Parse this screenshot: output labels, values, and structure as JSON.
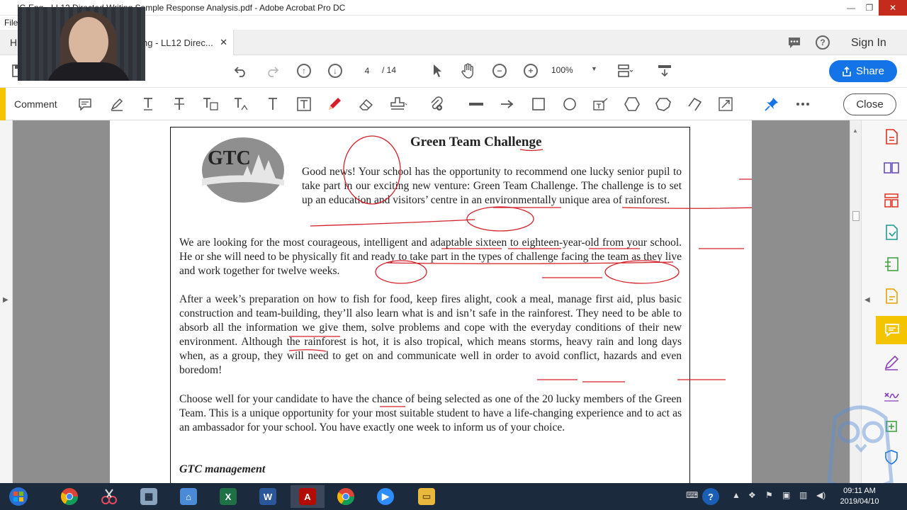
{
  "window": {
    "title": "IG Eng - LL12 Directed Writing Sample Response Analysis.pdf - Adobe Acrobat Pro DC",
    "minimize": "—",
    "maximize": "❐",
    "close": "✕"
  },
  "menu": {
    "file": "File"
  },
  "tabs": {
    "home": "H",
    "document": "ng - LL12 Direc...",
    "close": "✕",
    "sign_in": "Sign In"
  },
  "toolbar": {
    "page_current": "4",
    "page_total": "/ 14",
    "zoom": "100%",
    "share_label": "Share"
  },
  "comment_bar": {
    "label": "Comment",
    "close_label": "Close"
  },
  "document": {
    "title": "Green Team Challenge",
    "logo_text": "GTC",
    "paragraph1": "Good news! Your school has the opportunity to recommend one lucky senior pupil to take part in our exciting new venture: Green Team Challenge. The challenge is to set up an education and visitors’ centre in an environmentally unique area of rainforest.",
    "paragraph2": "We are looking for the most courageous, intelligent and adaptable sixteen to eighteen-year-old from your school. He or she will need to be physically fit and ready to take part in the types of challenge facing the team as they live and work together for twelve weeks.",
    "paragraph3": "After a week’s preparation on how to fish for food, keep fires alight, cook a meal, manage first aid, plus basic construction and team-building, they’ll also learn what is and isn’t safe in the rainforest. They need to be able to absorb all the information we give them, solve problems and cope with the everyday conditions of their new environment. Although the rainforest is hot, it is also tropical, which means storms, heavy rain and long days when, as a group, they will need to get on and communicate well in order to avoid conflict, hazards and even boredom!",
    "paragraph4": "Choose well for your candidate to have the chance of being selected as one of the 20 lucky members of the Green Team. This is a unique opportunity for your most suitable student to have a life-changing experience and to act as an ambassador for your school. You have exactly one week to inform us of your choice.",
    "signoff": "GTC management"
  },
  "taskbar": {
    "clock_time": "09:11 AM",
    "clock_date": "2019/04/10"
  },
  "colors": {
    "accent_blue": "#1473e6",
    "comment_yellow": "#f4c400",
    "annotation_red": "#d4202a"
  }
}
